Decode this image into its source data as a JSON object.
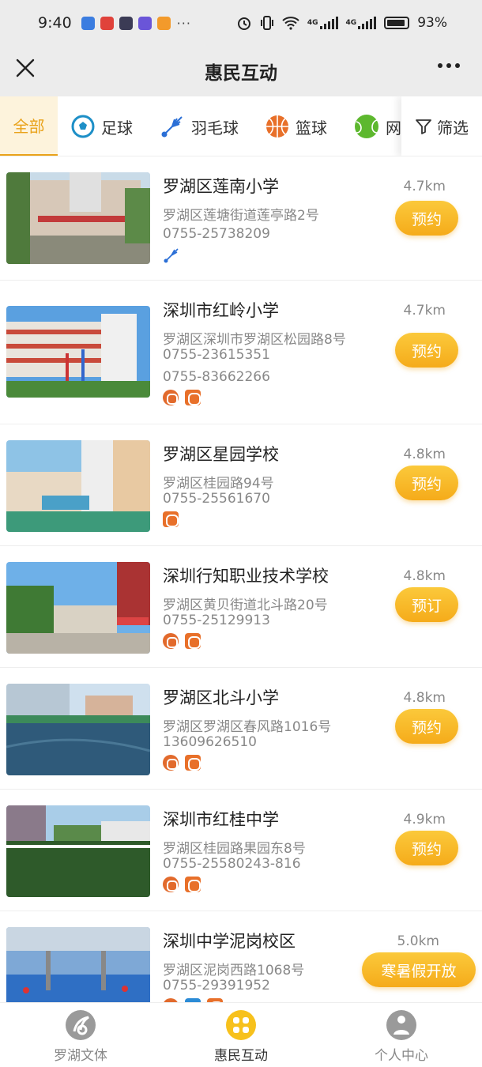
{
  "status_bar": {
    "time": "9:40",
    "more": "···",
    "network_1": "4G",
    "network_2": "4G",
    "battery": "93%",
    "app_icons": [
      {
        "name": "app-icon-blue",
        "color": "#3b7de0"
      },
      {
        "name": "app-icon-red",
        "color": "#e0423b"
      },
      {
        "name": "app-icon-dark",
        "color": "#3b3b55"
      },
      {
        "name": "app-icon-purple",
        "color": "#6a55d8"
      },
      {
        "name": "app-icon-orange",
        "color": "#f39a2b"
      }
    ]
  },
  "nav": {
    "title": "惠民互动"
  },
  "categories": {
    "tabs": [
      "全部",
      "足球",
      "羽毛球",
      "篮球",
      "网球"
    ],
    "active": "全部",
    "filter_label": "筛选"
  },
  "venues": [
    {
      "name": "罗湖区莲南小学",
      "address": "罗湖区莲塘街道莲亭路2号",
      "phones": [
        "0755-25738209"
      ],
      "distance": "4.7km",
      "button": "预约",
      "sports": [
        "badminton-icon"
      ]
    },
    {
      "name": "深圳市红岭小学",
      "address": "罗湖区深圳市罗湖区松园路8号",
      "phones": [
        "0755-23615351",
        "0755-83662266"
      ],
      "distance": "4.7km",
      "button": "预约",
      "sports": [
        "track-icon",
        "basketball-icon"
      ]
    },
    {
      "name": "罗湖区星园学校",
      "address": "罗湖区桂园路94号",
      "phones": [
        "0755-25561670"
      ],
      "distance": "4.8km",
      "button": "预约",
      "sports": [
        "basketball-icon"
      ]
    },
    {
      "name": "深圳行知职业技术学校",
      "address": "罗湖区黄贝街道北斗路20号",
      "phones": [
        "0755-25129913"
      ],
      "distance": "4.8km",
      "button": "预订",
      "sports": [
        "track-icon",
        "basketball-icon"
      ]
    },
    {
      "name": "罗湖区北斗小学",
      "address": "罗湖区罗湖区春风路1016号",
      "phones": [
        "13609626510"
      ],
      "distance": "4.8km",
      "button": "预约",
      "sports": [
        "track-icon",
        "basketball-icon"
      ]
    },
    {
      "name": "深圳市红桂中学",
      "address": "罗湖区桂园路果园东8号",
      "phones": [
        "0755-25580243-816"
      ],
      "distance": "4.9km",
      "button": "预约",
      "sports": [
        "track-icon",
        "basketball-icon"
      ]
    },
    {
      "name": "深圳中学泥岗校区",
      "address": "罗湖区泥岗西路1068号",
      "phones": [
        "0755-29391952"
      ],
      "distance": "5.0km",
      "button": "寒暑假开放",
      "sports": [
        "track-icon",
        "swim-icon",
        "basketball-icon"
      ]
    }
  ],
  "tab_bar": {
    "items": [
      "罗湖文体",
      "惠民互动",
      "个人中心"
    ],
    "active": "惠民互动"
  },
  "colors": {
    "accent": "#f5ab1a",
    "accent_light": "#fdf3dc"
  }
}
